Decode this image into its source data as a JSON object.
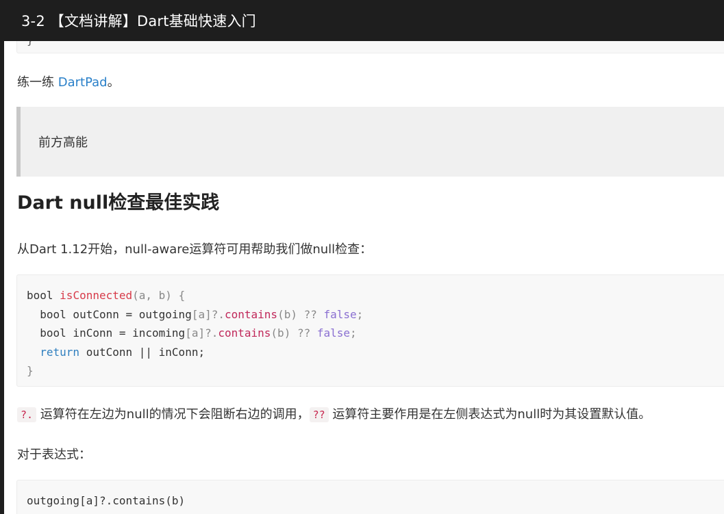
{
  "window": {
    "title": "3-2 【文档讲解】Dart基础快速入门"
  },
  "content": {
    "code_top_fragment": "}",
    "practice": {
      "prefix": "练一练 ",
      "link": "DartPad",
      "suffix": "。"
    },
    "quote": "前方高能",
    "heading": "Dart null检查最佳实践",
    "intro": "从Dart 1.12开始，null-aware运算符可用帮助我们做null检查：",
    "code1": {
      "line1": {
        "kw": "bool ",
        "fn": "isConnected",
        "args": "(a, b) {"
      },
      "line2": {
        "a": "  bool outConn = outgoing",
        "b": "[a]?.",
        "fn": "contains",
        "c": "(b) ?? ",
        "lit": "false",
        "d": ";"
      },
      "line3": {
        "a": "  bool inConn = incoming",
        "b": "[a]?.",
        "fn": "contains",
        "c": "(b) ?? ",
        "lit": "false",
        "d": ";"
      },
      "line4": {
        "kw": "  return",
        "a": " outConn || inConn;"
      },
      "line5": "}"
    },
    "explain": {
      "op1": "?.",
      "text1": " 运算符在左边为null的情况下会阻断右边的调用，",
      "op2": "??",
      "text2": " 运算符主要作用是在左侧表达式为null时为其设置默认值。"
    },
    "expr_label": "对于表达式：",
    "code2": "outgoing[a]?.contains(b)"
  }
}
